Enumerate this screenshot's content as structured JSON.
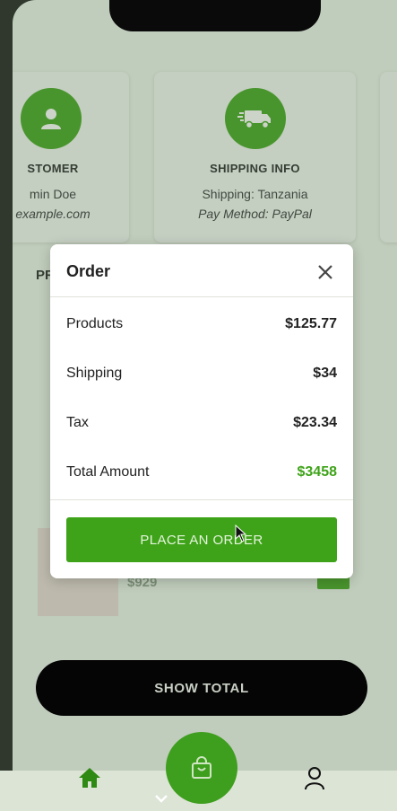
{
  "customer_card": {
    "title": "STOMER",
    "line1": "min Doe",
    "line2": "example.com"
  },
  "shipping_card": {
    "title": "SHIPPING INFO",
    "line1": "Shipping: Tanzania",
    "line2": "Pay Method: PayPal"
  },
  "products": {
    "title": "PR"
  },
  "background_price": "$929",
  "show_total": {
    "label": "SHOW TOTAL"
  },
  "modal": {
    "title": "Order",
    "rows": [
      {
        "label": "Products",
        "value": "$125.77"
      },
      {
        "label": "Shipping",
        "value": "$34"
      },
      {
        "label": "Tax",
        "value": "$23.34"
      },
      {
        "label": "Total Amount",
        "value": "$3458"
      }
    ],
    "button_label": "PLACE AN ORDER"
  },
  "tabs": {
    "home_icon": "home-icon",
    "cart_icon": "shopping-bag-icon",
    "user_icon": "user-icon"
  },
  "colors": {
    "accent": "#3ea319",
    "dark": "#050505"
  }
}
